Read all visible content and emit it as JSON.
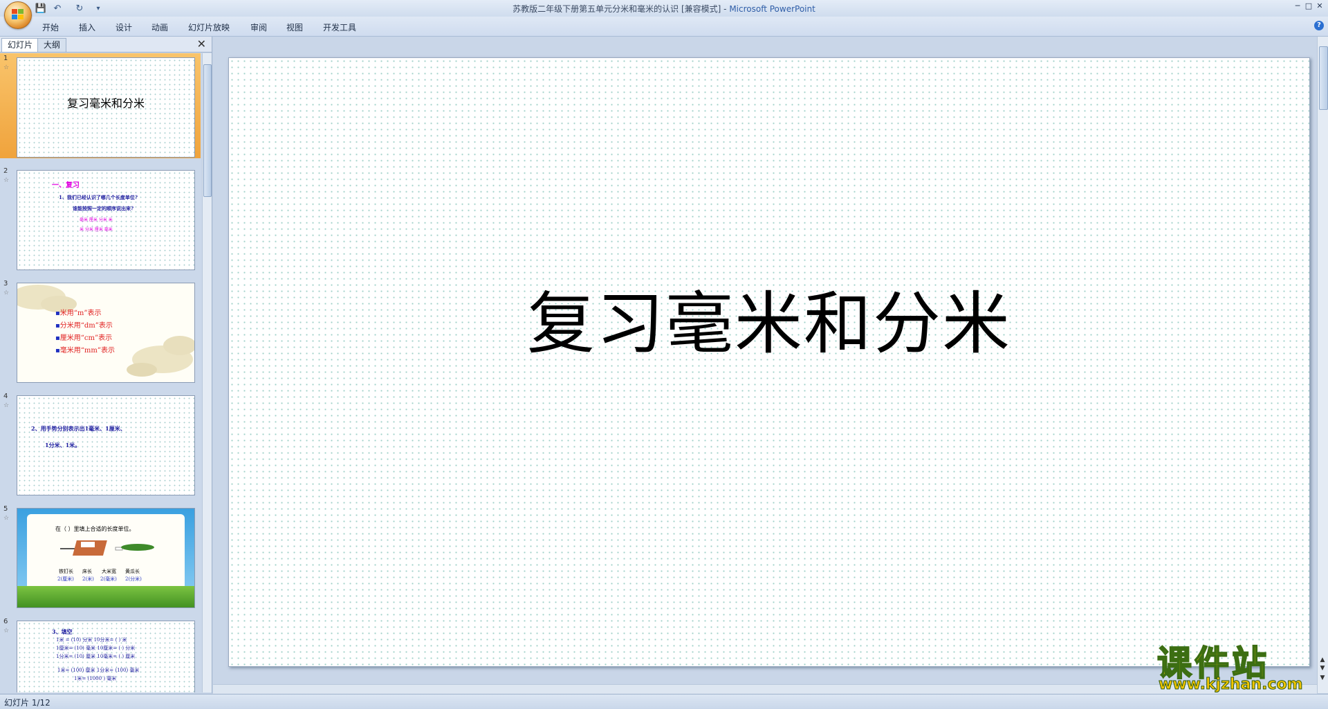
{
  "window": {
    "title": "苏教版二年级下册第五单元分米和毫米的认识 [兼容模式] - ",
    "app_name": "Microsoft PowerPoint",
    "controls": [
      "─",
      "□",
      "✕"
    ]
  },
  "quick_access": {
    "save": "💾",
    "undo": "↶",
    "redo": "↻",
    "customize": "▾"
  },
  "ribbon": {
    "tabs": [
      "开始",
      "插入",
      "设计",
      "动画",
      "幻灯片放映",
      "审阅",
      "视图",
      "开发工具"
    ],
    "help": "?"
  },
  "left_panel": {
    "tabs": {
      "slides": "幻灯片",
      "outline": "大纲"
    },
    "close": "✕"
  },
  "thumbnails": [
    {
      "num": "1",
      "selected": true,
      "title": "复习毫米和分米"
    },
    {
      "num": "2",
      "lines": [
        "一、复习",
        "1、我们已经认识了哪几个长度单位?",
        "谁能按照一定的顺序说出来?",
        "毫米 厘米 分米 米",
        "米 分米 厘米 毫米"
      ]
    },
    {
      "num": "3",
      "lines": [
        "米用“m”表示",
        "分米用“dm”表示",
        "厘米用“cm”表示",
        "毫米用“mm”表示"
      ]
    },
    {
      "num": "4",
      "lines": [
        "2、用手势分别表示出1毫米、1厘米、",
        "1分米、1米。"
      ]
    },
    {
      "num": "5",
      "lines": [
        "在（ ）里填上合适的长度单位。",
        "铁钉长",
        "床长",
        "大米宽",
        "黄瓜长",
        "2(厘米)",
        "2(米)",
        "2(毫米)",
        "2(分米)"
      ]
    },
    {
      "num": "6",
      "lines": [
        "3、填空",
        "1米 = (10) 分米    10分米= ( ) 米",
        "1厘米= (10) 毫米   10厘米= ( ) 分米",
        "1分米= (10) 厘米   10毫米= ( ) 厘米",
        "1米= (100) 厘米    1分米= (100) 毫米",
        "1米= (1000 ) 毫米"
      ]
    }
  ],
  "slide": {
    "title": "复习毫米和分米"
  },
  "status": {
    "text": "幻灯片 1/12"
  },
  "watermark": {
    "cn": "课件站",
    "url": "www.kjzhan.com"
  },
  "colors": {
    "accent": "#f0a33c",
    "brand": "#2f5ea8",
    "dots": "#9fd0c8"
  }
}
